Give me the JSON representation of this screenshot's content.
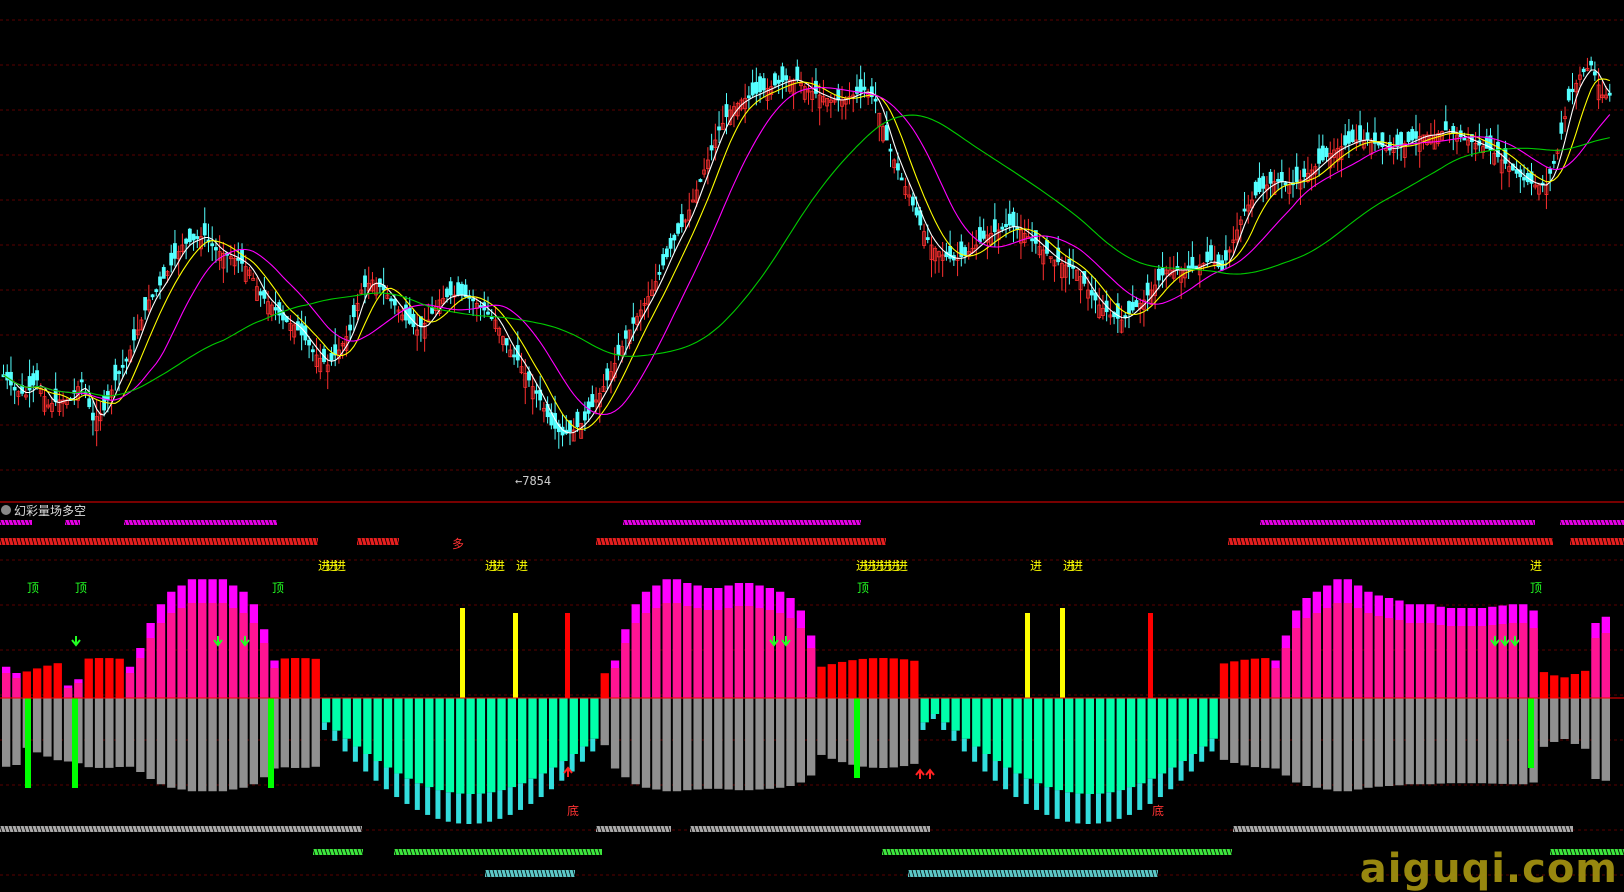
{
  "indicator_title": "幻彩量场多空",
  "price_low_label": "←7854",
  "watermark": "aiguqi.com",
  "colors": {
    "up_candle": "#ff3030",
    "down_candle": "#54ffff",
    "ma_fast": "#ffffff",
    "ma_mid": "#ffff00",
    "ma_slow": "#ff00ff",
    "ma_long": "#00cc00",
    "top_bar": "#ff00ff",
    "mid_bar": "#ff1493",
    "red_bar": "#ff0000",
    "yellow_bar": "#ffff00",
    "gray_bar": "#909090",
    "green_bar": "#00ff00",
    "aqua_fill": "#00ffaa",
    "cyan_bar": "#33dddd"
  },
  "chart_data": [
    {
      "type": "candlestick",
      "title": "",
      "annotations": [
        {
          "label": "←7854",
          "note": "period low"
        }
      ],
      "close_path": [
        375,
        390,
        395,
        380,
        405,
        400,
        400,
        380,
        420,
        410,
        380,
        360,
        330,
        300,
        285,
        265,
        245,
        240,
        235,
        250,
        255,
        260,
        270,
        295,
        305,
        320,
        325,
        340,
        355,
        365,
        350,
        330,
        290,
        280,
        290,
        305,
        320,
        330,
        320,
        300,
        295,
        295,
        300,
        310,
        320,
        345,
        360,
        380,
        400,
        425,
        435,
        430,
        420,
        400,
        380,
        355,
        330,
        310,
        290,
        265,
        240,
        220,
        190,
        160,
        130,
        110,
        100,
        95,
        90,
        85,
        80,
        80,
        90,
        95,
        100,
        100,
        95,
        90,
        100,
        140,
        170,
        195,
        225,
        245,
        255,
        260,
        255,
        245,
        235,
        230,
        225,
        230,
        240,
        250,
        260,
        265,
        270,
        290,
        305,
        315,
        320,
        310,
        300,
        285,
        270,
        270,
        270,
        265,
        260,
        270,
        240,
        210,
        195,
        185,
        180,
        185,
        180,
        170,
        160,
        150,
        145,
        140,
        140,
        145,
        150,
        145,
        140,
        135,
        135,
        130,
        135,
        140,
        145,
        150,
        160,
        170,
        180,
        185,
        185,
        150,
        100,
        75,
        65,
        95
      ]
    },
    {
      "type": "bar",
      "title": "幻彩量场多空",
      "text_markers": [
        {
          "label": "顶",
          "count": 5
        },
        {
          "label": "进",
          "count": 16
        },
        {
          "label": "多",
          "count": 1
        },
        {
          "label": "底",
          "count": 2
        }
      ],
      "magenta_top": [
        0.25,
        0.2,
        0,
        0,
        0,
        0,
        0.1,
        0.15,
        0,
        0,
        0,
        0,
        0.25,
        0.4,
        0.6,
        0.75,
        0.85,
        0.9,
        0.95,
        0.95,
        0.95,
        0.95,
        0.9,
        0.85,
        0.75,
        0.55,
        0.3,
        0.0,
        0,
        0,
        0,
        0,
        0,
        0,
        0,
        0,
        0,
        0,
        0,
        0,
        0,
        0,
        0,
        0,
        0,
        0,
        0,
        0,
        0,
        0,
        0,
        0,
        0,
        0,
        0,
        0,
        0,
        0,
        0,
        0.3,
        0.55,
        0.75,
        0.85,
        0.9,
        0.95,
        0.95,
        0.92,
        0.9,
        0.88,
        0.88,
        0.9,
        0.92,
        0.92,
        0.9,
        0.88,
        0.85,
        0.8,
        0.7,
        0.5,
        0,
        0,
        0,
        0,
        0,
        0,
        0,
        0,
        0,
        0,
        0,
        0,
        0,
        0,
        0,
        0,
        0,
        0,
        0,
        0,
        0,
        0,
        0,
        0,
        0,
        0,
        0,
        0,
        0,
        0,
        0,
        0,
        0,
        0,
        0,
        0,
        0,
        0,
        0,
        0,
        0,
        0,
        0,
        0,
        0.3,
        0.5,
        0.7,
        0.8,
        0.85,
        0.9,
        0.95,
        0.95,
        0.9,
        0.85,
        0.82,
        0.8,
        0.78,
        0.75,
        0.75,
        0.75,
        0.73,
        0.72,
        0.72,
        0.72,
        0.72,
        0.73,
        0.74,
        0.75,
        0.75,
        0.7,
        0,
        0,
        0,
        0,
        0,
        0.6,
        0.65
      ]
    }
  ]
}
